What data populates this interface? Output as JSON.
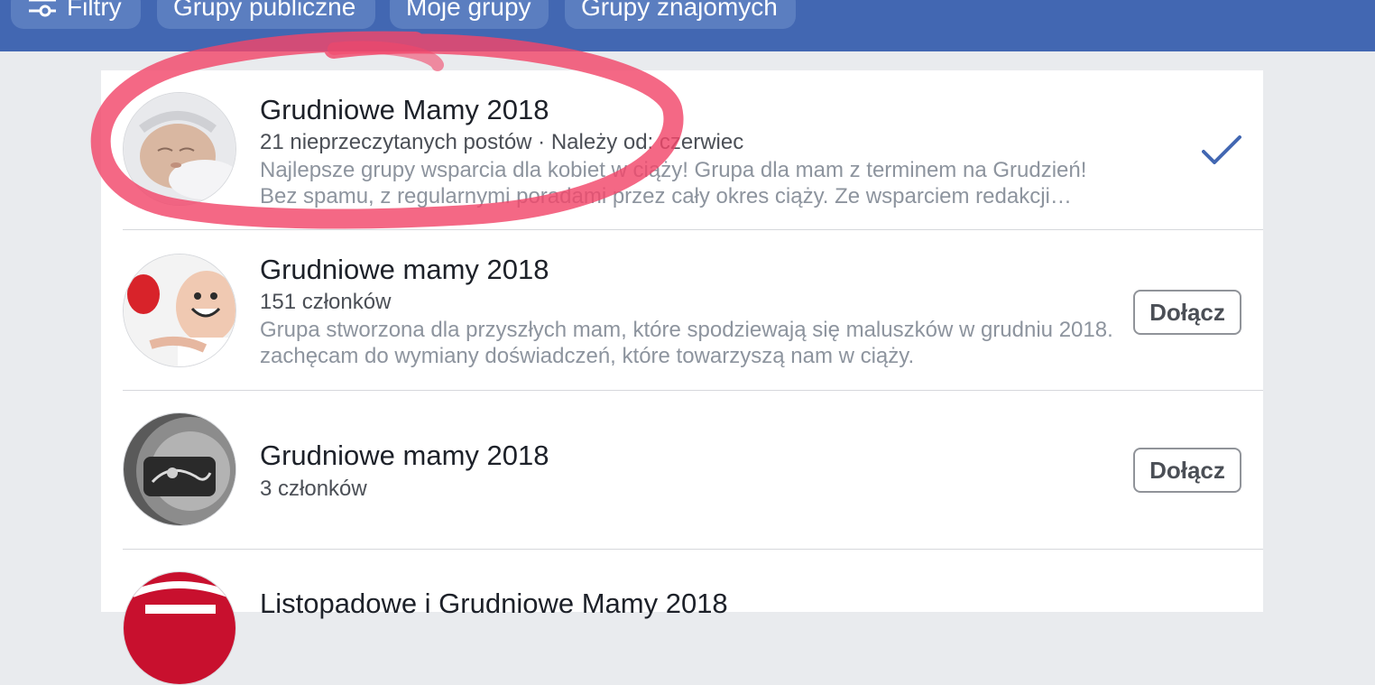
{
  "filters": {
    "filters_label": "Filtry",
    "public_groups_label": "Grupy publiczne",
    "my_groups_label": "Moje grupy",
    "friends_groups_label": "Grupy znajomych"
  },
  "groups": [
    {
      "name": "Grudniowe Mamy 2018",
      "meta": "21 nieprzeczytanych postów · Należy od: czerwiec",
      "description": "Najlepsze grupy wsparcia dla kobiet w ciąży! Grupa dla mam z terminem na Grudzień! Bez spamu, z regularnymi poradami przez cały okres ciąży. Ze wsparciem redakcji serwisu h…",
      "status_icon": "checkmark-icon"
    },
    {
      "name": "Grudniowe mamy 2018",
      "meta": "151 członków",
      "description": "Grupa stworzona dla przyszłych mam, które spodziewają się maluszków w grudniu 2018. zachęcam do wymiany doświadczeń, które towarzyszą nam w ciąży.",
      "action_label": "Dołącz"
    },
    {
      "name": "Grudniowe mamy 2018",
      "meta": "3 członków",
      "action_label": "Dołącz"
    },
    {
      "name": "Listopadowe i Grudniowe Mamy 2018"
    }
  ],
  "colors": {
    "header_blue": "#4267b2",
    "accent_blue": "#4267b2",
    "annotation_red": "#f2476a"
  }
}
